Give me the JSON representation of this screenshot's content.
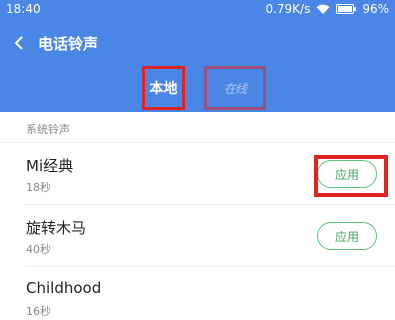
{
  "status_bar": {
    "time": "18:40",
    "speed": "0.79K/s",
    "battery": "96%"
  },
  "header": {
    "title": "电话铃声"
  },
  "tabs": [
    {
      "label": "本地"
    },
    {
      "label": "在线"
    }
  ],
  "section": {
    "label": "系统铃声"
  },
  "ringtones": [
    {
      "name": "Mi经典",
      "duration": "18秒",
      "action": "应用"
    },
    {
      "name": "旋转木马",
      "duration": "40秒",
      "action": "应用"
    },
    {
      "name": "Childhood",
      "duration": "16秒"
    }
  ],
  "colors": {
    "header_bg": "#4a86e6",
    "apply_green": "#3aa95f",
    "highlight_red": "#e02424"
  }
}
